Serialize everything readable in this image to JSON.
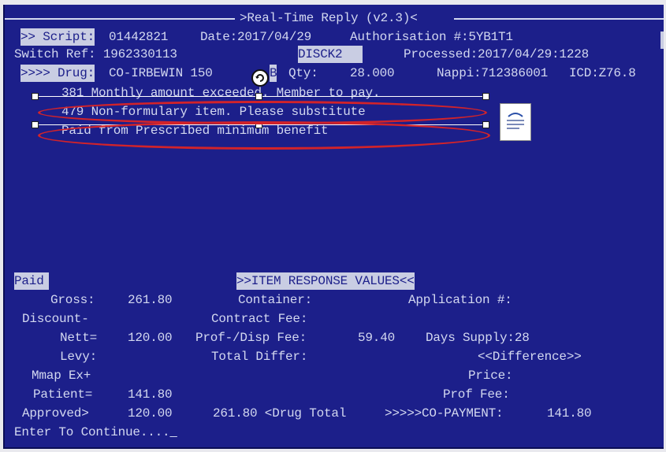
{
  "header": {
    "title": ">Real-Time Reply (v2.3)<"
  },
  "row_script": {
    "prefix": ">> Script:",
    "script_no": "01442821",
    "date": "Date:2017/04/29",
    "authorisation": "Authorisation #:5YB1T1"
  },
  "row_switch": {
    "switch_ref": "Switch Ref: 1962330113",
    "code": "DISCK2",
    "processed": "Processed:2017/04/29:1228"
  },
  "row_drug": {
    "prefix": ">>>> Drug:",
    "drug_name": "CO-IRBEWIN 150",
    "tab_suffix": "B",
    "qty_label": "Qty:",
    "qty_value": "28.000",
    "nappi": "Nappi:712386001",
    "icd": "ICD:Z76.8"
  },
  "messages": [
    "381 Monthly amount exceeded. Member to pay.",
    "479 Non-formulary item. Please substitute",
    "Paid from Prescribed minimum benefit"
  ],
  "status": {
    "paid": "Paid",
    "section_title": ">>ITEM RESPONSE VALUES<<"
  },
  "values": {
    "gross_label": "Gross:",
    "gross": "261.80",
    "container_label": "Container:",
    "application_label": "Application #:",
    "discount_label": "Discount-",
    "contract_fee_label": "Contract Fee:",
    "nett_label": "Nett=",
    "nett": "120.00",
    "prof_disp_label": "Prof-/Disp Fee:",
    "prof_disp": "59.40",
    "days_supply": "Days Supply:28",
    "levy_label": "Levy:",
    "total_differ_label": "Total Differ:",
    "difference_label": "<<Difference>>",
    "mmap_label": "Mmap Ex+",
    "price_label": "Price:",
    "patient_label": "Patient=",
    "patient": "141.80",
    "prof_fee_label": "Prof Fee:",
    "approved_label": "Approved>",
    "approved": "120.00",
    "drug_total": "261.80 <Drug Total",
    "copayment_label": ">>>>>CO-PAYMENT:",
    "copayment": "141.80"
  },
  "footer": {
    "prompt": "Enter To Continue...."
  },
  "icons": {
    "cursor": "rotate-cursor-icon",
    "document": "document-icon",
    "annotation": "red-ellipse"
  },
  "colors": {
    "screen_bg": "#1c1f8a",
    "text": "#d3d8f0",
    "highlight": "#c9cde3",
    "annotation": "#d2232a"
  }
}
